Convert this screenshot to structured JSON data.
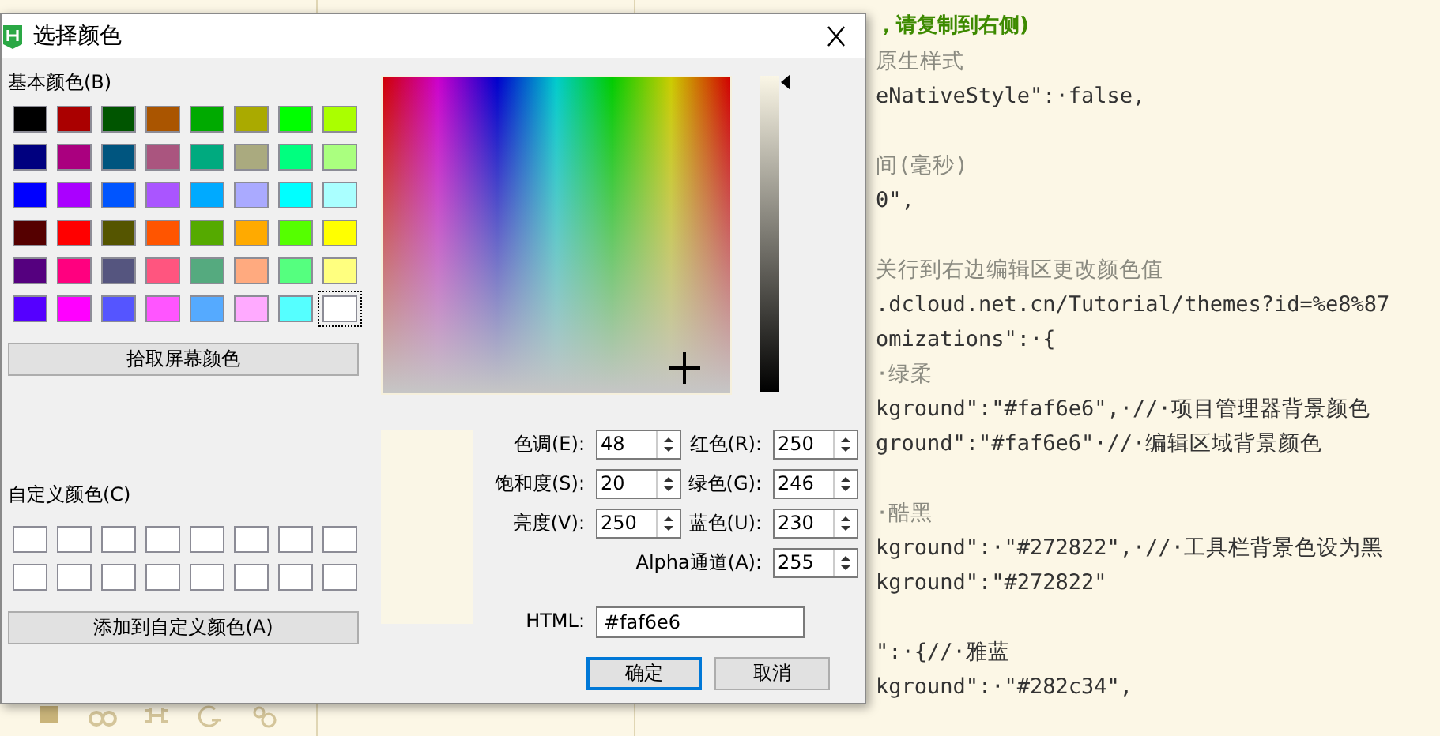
{
  "editor": {
    "lines": [
      {
        "kind": "heading",
        "text": "，请复制到右侧)"
      },
      {
        "kind": "comment",
        "text": "原生样式"
      },
      {
        "kind": "code",
        "text": "eNativeStyle\":·false,"
      },
      {
        "kind": "blank"
      },
      {
        "kind": "comment",
        "text": "间(毫秒)"
      },
      {
        "kind": "code",
        "text": "0\","
      },
      {
        "kind": "blank"
      },
      {
        "kind": "comment",
        "text": "关行到右边编辑区更改颜色值"
      },
      {
        "kind": "code",
        "text": ".dcloud.net.cn/Tutorial/themes?id=%e8%87"
      },
      {
        "kind": "code",
        "text": "omizations\":·{"
      },
      {
        "kind": "comment",
        "text": "·绿柔"
      },
      {
        "kind": "code",
        "text": "kground\":\"#faf6e6\",·//·项目管理器背景颜色"
      },
      {
        "kind": "code",
        "text": "ground\":\"#faf6e6\"·//·编辑区域背景颜色"
      },
      {
        "kind": "blank"
      },
      {
        "kind": "comment",
        "text": "·酷黑"
      },
      {
        "kind": "code",
        "text": "kground\":·\"#272822\",·//·工具栏背景色设为黑"
      },
      {
        "kind": "code",
        "text": "kground\":\"#272822\""
      },
      {
        "kind": "blank"
      },
      {
        "kind": "code",
        "text": "\":·{//·雅蓝"
      },
      {
        "kind": "code",
        "text": "kground\":·\"#282c34\","
      }
    ]
  },
  "dialog": {
    "title": "选择颜色",
    "basic_label": "基本颜色(B)",
    "basic_colors": [
      {
        "color": "#000000",
        "selected": false
      },
      {
        "color": "#aa0000",
        "selected": false
      },
      {
        "color": "#005500",
        "selected": false
      },
      {
        "color": "#aa5500",
        "selected": false
      },
      {
        "color": "#00aa00",
        "selected": false
      },
      {
        "color": "#aaaa00",
        "selected": false
      },
      {
        "color": "#00ff00",
        "selected": false
      },
      {
        "color": "#aaff00",
        "selected": false
      },
      {
        "color": "#00007f",
        "selected": false
      },
      {
        "color": "#aa007f",
        "selected": false
      },
      {
        "color": "#00557f",
        "selected": false
      },
      {
        "color": "#aa557f",
        "selected": false
      },
      {
        "color": "#00aa7f",
        "selected": false
      },
      {
        "color": "#aaaa7f",
        "selected": false
      },
      {
        "color": "#00ff7f",
        "selected": false
      },
      {
        "color": "#aaff7f",
        "selected": false
      },
      {
        "color": "#0000ff",
        "selected": false
      },
      {
        "color": "#aa00ff",
        "selected": false
      },
      {
        "color": "#0055ff",
        "selected": false
      },
      {
        "color": "#aa55ff",
        "selected": false
      },
      {
        "color": "#00aaff",
        "selected": false
      },
      {
        "color": "#aaaaff",
        "selected": false
      },
      {
        "color": "#00ffff",
        "selected": false
      },
      {
        "color": "#aaffff",
        "selected": false
      },
      {
        "color": "#550000",
        "selected": false
      },
      {
        "color": "#ff0000",
        "selected": false
      },
      {
        "color": "#555500",
        "selected": false
      },
      {
        "color": "#ff5500",
        "selected": false
      },
      {
        "color": "#55aa00",
        "selected": false
      },
      {
        "color": "#ffaa00",
        "selected": false
      },
      {
        "color": "#55ff00",
        "selected": false
      },
      {
        "color": "#ffff00",
        "selected": false
      },
      {
        "color": "#55007f",
        "selected": false
      },
      {
        "color": "#ff007f",
        "selected": false
      },
      {
        "color": "#55557f",
        "selected": false
      },
      {
        "color": "#ff557f",
        "selected": false
      },
      {
        "color": "#55aa7f",
        "selected": false
      },
      {
        "color": "#ffaa7f",
        "selected": false
      },
      {
        "color": "#55ff7f",
        "selected": false
      },
      {
        "color": "#ffff7f",
        "selected": false
      },
      {
        "color": "#5500ff",
        "selected": false
      },
      {
        "color": "#ff00ff",
        "selected": false
      },
      {
        "color": "#5555ff",
        "selected": false
      },
      {
        "color": "#ff55ff",
        "selected": false
      },
      {
        "color": "#55aaff",
        "selected": false
      },
      {
        "color": "#ffaaff",
        "selected": false
      },
      {
        "color": "#55ffff",
        "selected": false
      },
      {
        "color": "#ffffff",
        "selected": true
      }
    ],
    "pick_button": "拾取屏幕颜色",
    "custom_label": "自定义颜色(C)",
    "custom_colors": [
      {
        "kind": "empty"
      },
      {
        "kind": "empty"
      },
      {
        "kind": "empty"
      },
      {
        "kind": "empty"
      },
      {
        "kind": "empty"
      },
      {
        "kind": "empty"
      },
      {
        "kind": "empty"
      },
      {
        "kind": "empty"
      },
      {
        "kind": "empty"
      },
      {
        "kind": "empty"
      },
      {
        "kind": "empty"
      },
      {
        "kind": "empty"
      },
      {
        "kind": "empty"
      },
      {
        "kind": "empty"
      },
      {
        "kind": "empty"
      },
      {
        "kind": "empty"
      }
    ],
    "add_button": "添加到自定义颜色(A)",
    "hsv_fields": [
      {
        "label": "色调(E):",
        "value": "48"
      },
      {
        "label": "饱和度(S):",
        "value": "20"
      },
      {
        "label": "亮度(V):",
        "value": "250"
      }
    ],
    "rgb_fields": [
      {
        "label": "红色(R):",
        "value": "250"
      },
      {
        "label": "绿色(G):",
        "value": "246"
      },
      {
        "label": "蓝色(U):",
        "value": "230"
      }
    ],
    "alpha_field": {
      "label": "Alpha通道(A):",
      "value": "255"
    },
    "html_field": {
      "label": "HTML:",
      "value": "#faf6e6"
    },
    "buttons": [
      {
        "label": "确定",
        "default": true
      },
      {
        "label": "取消",
        "default": false
      }
    ]
  }
}
